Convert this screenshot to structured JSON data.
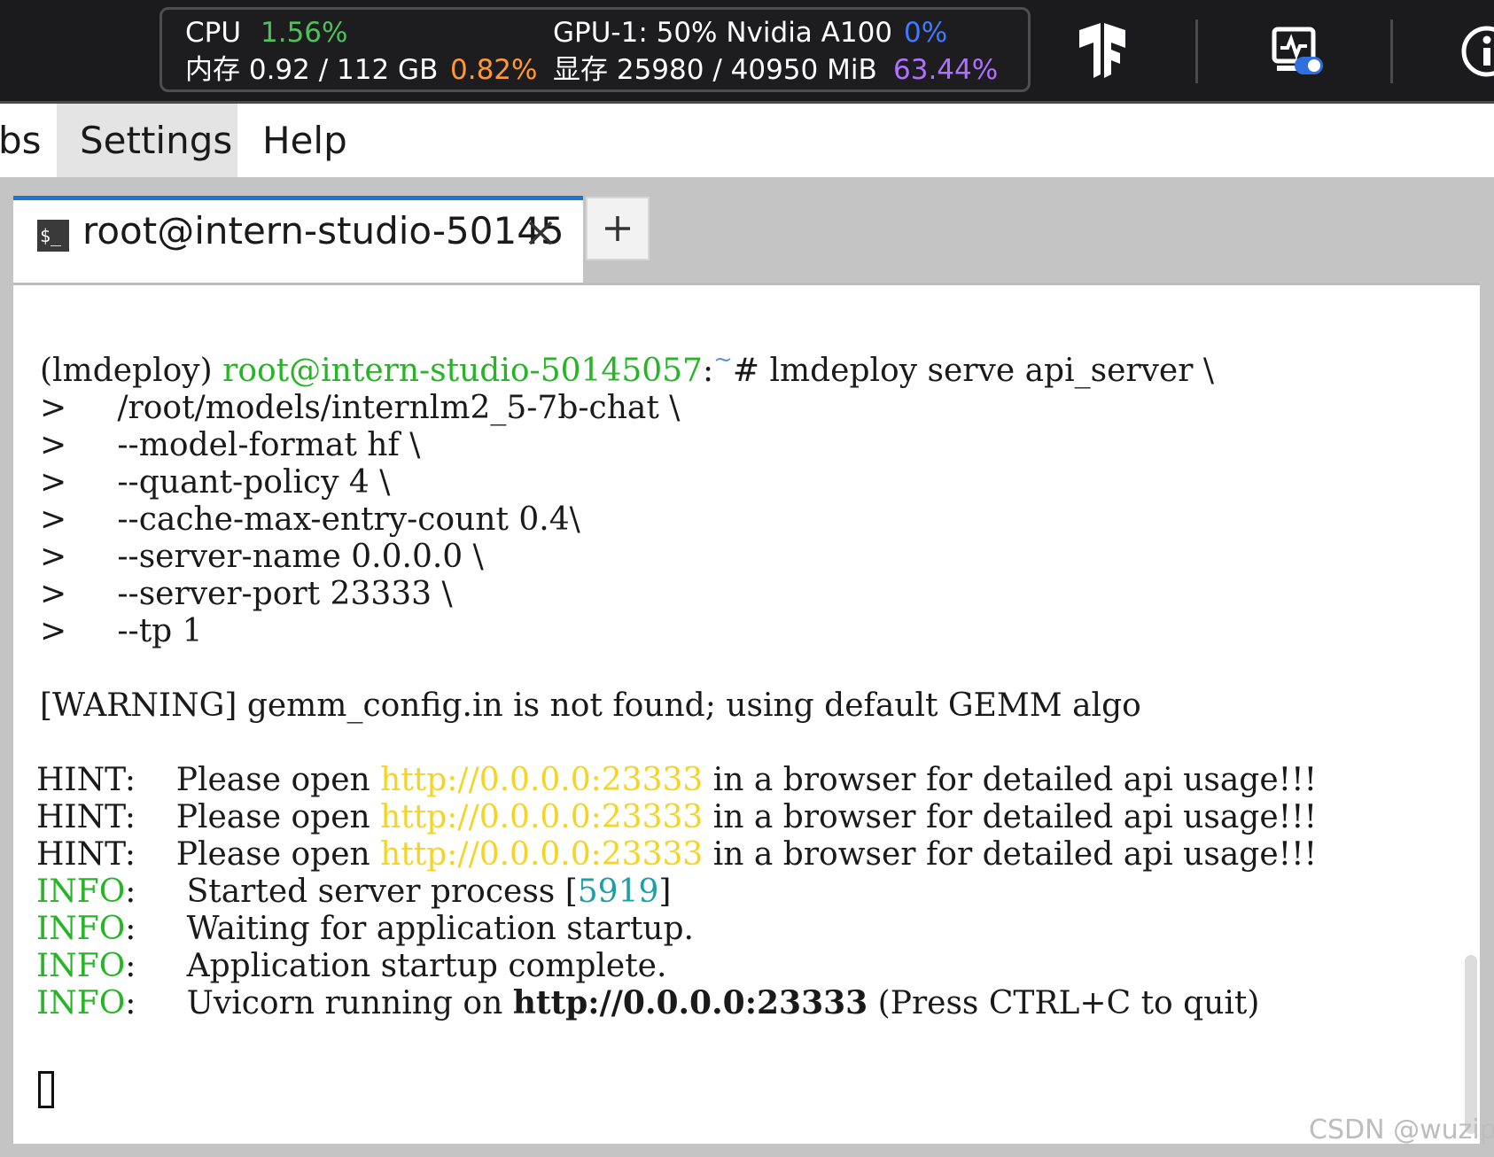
{
  "monitor": {
    "cpu_label": "CPU",
    "cpu_value": "1.56%",
    "mem_label": "内存 0.92 / 112 GB",
    "mem_value": "0.82%",
    "gpu_label": "GPU-1: 50% Nvidia A100",
    "gpu_value": "0%",
    "vram_label": "显存 25980 / 40950 MiB",
    "vram_value": "63.44%"
  },
  "top_icons": [
    "tensorflow-icon",
    "monitor-toggle-icon",
    "info-icon"
  ],
  "menu": {
    "items": [
      "bs",
      "Settings",
      "Help"
    ],
    "active": "Settings"
  },
  "tab": {
    "title": "root@intern-studio-50145",
    "icon": "terminal-icon"
  },
  "terminal": {
    "env": "(lmdeploy)",
    "prompt_user": "root@intern-studio-50145057",
    "prompt_sep": ":",
    "prompt_dir": "~",
    "prompt_cmd": "# lmdeploy serve api_server \\",
    "continuation": [
      ">     /root/models/internlm2_5-7b-chat \\",
      ">     --model-format hf \\",
      ">     --quant-policy 4 \\",
      ">     --cache-max-entry-count 0.4\\",
      ">     --server-name 0.0.0.0 \\",
      ">     --server-port 23333 \\",
      ">     --tp 1"
    ],
    "warning": "[WARNING] gemm_config.in is not found; using default GEMM algo",
    "hint_label": "HINT:",
    "hint_pre": "    Please open ",
    "hint_url": "http://0.0.0.0:23333",
    "hint_post": " in a browser for detailed api usage!!!",
    "info_label": "INFO",
    "info_colon": ":",
    "info_lines": [
      "     Started server process ",
      "     Waiting for application startup.",
      "     Application startup complete.",
      "     Uvicorn running on "
    ],
    "pid_open": "[",
    "pid": "5919",
    "pid_close": "]",
    "uvicorn_url": "http://0.0.0.0:23333",
    "uvicorn_post": " (Press CTRL+C to quit)"
  },
  "watermark": "CSDN @wuzipl",
  "colors": {
    "prompt_green": "#26b526",
    "url_yellow": "#f5d427",
    "pid_cyan": "#1e9ea6",
    "tab_accent": "#1976d2"
  }
}
